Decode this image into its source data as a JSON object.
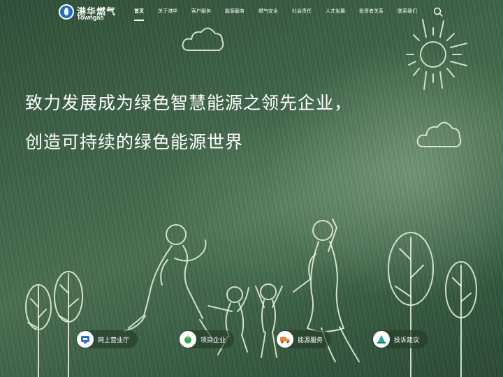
{
  "brand": {
    "name_cn": "港华燃气",
    "name_en": "Towngas"
  },
  "nav": {
    "items": [
      {
        "label": "首页",
        "active": true
      },
      {
        "label": "关于港华",
        "active": false
      },
      {
        "label": "客户服务",
        "active": false
      },
      {
        "label": "能源服务",
        "active": false
      },
      {
        "label": "燃气安全",
        "active": false
      },
      {
        "label": "社会责任",
        "active": false
      },
      {
        "label": "人才发展",
        "active": false
      },
      {
        "label": "投资者关系",
        "active": false
      },
      {
        "label": "联系我们",
        "active": false
      }
    ],
    "search_icon": "search-icon"
  },
  "hero": {
    "line1": "致力发展成为绿色智慧能源之领先企业，",
    "line2": "创造可持续的绿色能源世界"
  },
  "quick_links": [
    {
      "label": "网上营业厅",
      "icon": "online-hall-icon",
      "color": "#2c6fd1"
    },
    {
      "label": "项目企业",
      "icon": "project-icon",
      "color": "#3aa35a"
    },
    {
      "label": "能源服务",
      "icon": "energy-truck-icon",
      "color": "#e8822a"
    },
    {
      "label": "投诉建议",
      "icon": "complaint-icon",
      "color": "#1fa7a0"
    }
  ],
  "colors": {
    "accent_blue": "#1f6fc4",
    "text": "#ffffff"
  }
}
